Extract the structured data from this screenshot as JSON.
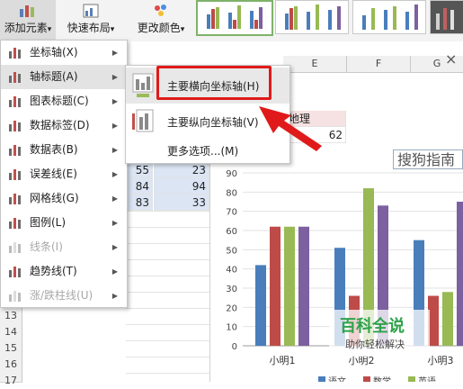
{
  "ribbon": {
    "add_element": "添加元素",
    "quick_layout": "快速布局",
    "change_color": "更改颜色",
    "dropdown_caret": "▾"
  },
  "sheet": {
    "columns": [
      "E",
      "F",
      "G"
    ],
    "rows": [
      "13",
      "14",
      "15",
      "16",
      "17",
      "18",
      "19"
    ],
    "header_cell": "地理",
    "cells_c1": [
      "55",
      "84",
      "83"
    ],
    "cells_c2": [
      "23",
      "94",
      "33"
    ],
    "value_62": "62"
  },
  "menu": {
    "items": [
      {
        "label": "坐标轴(X)",
        "icon": "axis-icon",
        "enabled": true,
        "submenu": true
      },
      {
        "label": "轴标题(A)",
        "icon": "axis-title-icon",
        "enabled": true,
        "submenu": true,
        "active": true
      },
      {
        "label": "图表标题(C)",
        "icon": "chart-title-icon",
        "enabled": true,
        "submenu": true
      },
      {
        "label": "数据标签(D)",
        "icon": "data-labels-icon",
        "enabled": true,
        "submenu": true
      },
      {
        "label": "数据表(B)",
        "icon": "data-table-icon",
        "enabled": true,
        "submenu": true
      },
      {
        "label": "误差线(E)",
        "icon": "error-bars-icon",
        "enabled": true,
        "submenu": true
      },
      {
        "label": "网格线(G)",
        "icon": "gridlines-icon",
        "enabled": true,
        "submenu": true
      },
      {
        "label": "图例(L)",
        "icon": "legend-icon",
        "enabled": true,
        "submenu": true
      },
      {
        "label": "线条(I)",
        "icon": "lines-icon",
        "enabled": false,
        "submenu": true
      },
      {
        "label": "趋势线(T)",
        "icon": "trendline-icon",
        "enabled": true,
        "submenu": true
      },
      {
        "label": "涨/跌柱线(U)",
        "icon": "updown-bars-icon",
        "enabled": false,
        "submenu": true
      }
    ]
  },
  "submenu": {
    "primary_horizontal": "主要横向坐标轴(H)",
    "primary_vertical": "主要纵向坐标轴(V)",
    "more_options": "更多选项...(M)"
  },
  "chart_data": {
    "type": "bar",
    "title": "搜狗指南",
    "categories": [
      "小明1",
      "小明2",
      "小明3"
    ],
    "ylim": [
      0,
      90
    ],
    "yticks": [
      "0",
      "10",
      "20",
      "30",
      "40",
      "50",
      "60",
      "70",
      "80",
      "90"
    ],
    "series": [
      {
        "name": "语文",
        "color": "#4a7ebb",
        "values": [
          42,
          51,
          55
        ]
      },
      {
        "name": "数学",
        "color": "#be4b48",
        "values": [
          62,
          26,
          26
        ]
      },
      {
        "name": "英语",
        "color": "#98b954",
        "values": [
          62,
          82,
          28
        ]
      },
      {
        "name": "",
        "color": "#7d60a0",
        "values": [
          62,
          73,
          75
        ]
      }
    ],
    "grid": true,
    "legend": "bottom"
  },
  "watermark": {
    "title": "百科全说",
    "subtitle": "助你轻松解决"
  },
  "colors": {
    "highlight_red": "#e01a1a",
    "menu_active": "#e3e3e3",
    "cell_highlight": "#dbe5f3"
  }
}
